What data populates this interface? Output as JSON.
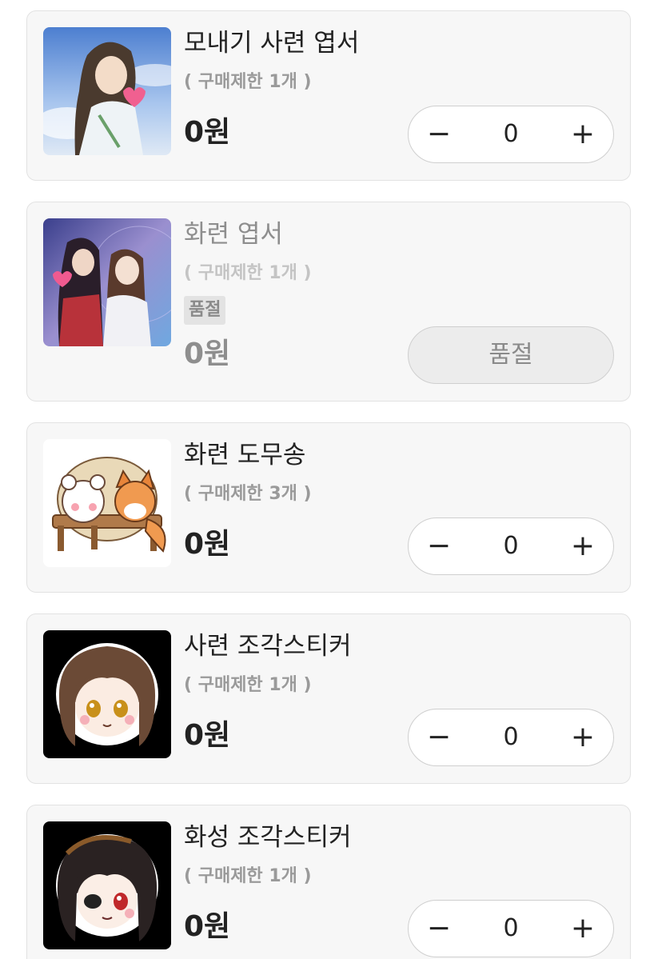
{
  "products": [
    {
      "title": "모내기 사련 엽서",
      "limit": "( 구매제한 1개 )",
      "price": "0원",
      "qty": "0",
      "minus": "−",
      "plus": "+",
      "image_icon": "character-illustration-icon"
    },
    {
      "title": "화련 엽서",
      "limit": "( 구매제한 1개 )",
      "badge": "품절",
      "price": "0원",
      "soldout_button": "품절",
      "image_icon": "couple-illustration-icon"
    },
    {
      "title": "화련 도무송",
      "limit": "( 구매제한 3개 )",
      "price": "0원",
      "qty": "0",
      "minus": "−",
      "plus": "+",
      "image_icon": "bear-fox-sticker-icon"
    },
    {
      "title": "사련 조각스티커",
      "limit": "( 구매제한 1개 )",
      "price": "0원",
      "qty": "0",
      "minus": "−",
      "plus": "+",
      "image_icon": "chibi-xie-lian-icon"
    },
    {
      "title": "화성 조각스티커",
      "limit": "( 구매제한 1개 )",
      "price": "0원",
      "qty": "0",
      "minus": "−",
      "plus": "+",
      "image_icon": "chibi-hua-cheng-icon"
    }
  ]
}
